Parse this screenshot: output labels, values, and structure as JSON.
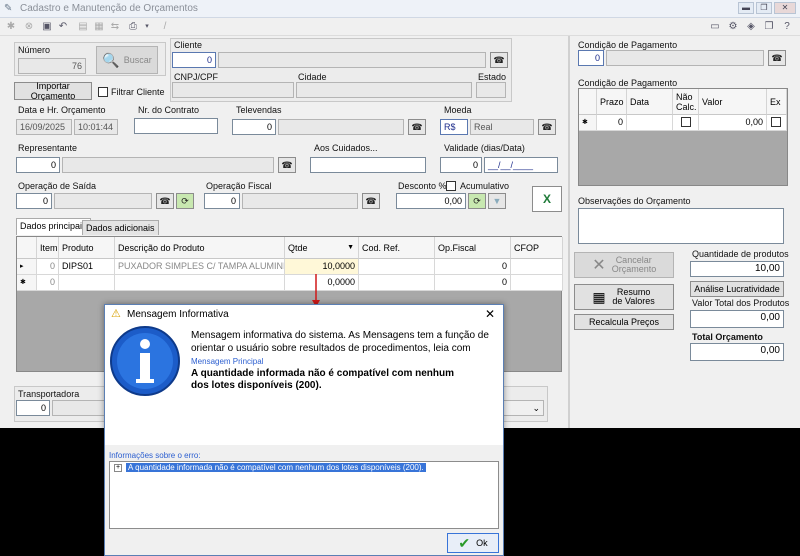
{
  "window": {
    "title": "Cadastro e Manutenção de Orçamentos"
  },
  "header": {
    "numero_label": "Número",
    "numero_value": "76",
    "buscar_label": "Buscar",
    "importar_label": "Importar Orçamento",
    "filtrar_label": "Filtrar Cliente",
    "cliente_label": "Cliente",
    "cliente_code": "0",
    "cnpj_label": "CNPJ/CPF",
    "cidade_label": "Cidade",
    "estado_label": "Estado"
  },
  "row2": {
    "data_label": "Data e Hr. Orçamento",
    "data_value": "16/09/2025",
    "hora_value": "10:01:44",
    "contrato_label": "Nr. do Contrato",
    "televendas_label": "Televendas",
    "televendas_value": "0",
    "moeda_label": "Moeda",
    "moeda_code": "R$",
    "moeda_name": "Real"
  },
  "row3": {
    "representante_label": "Representante",
    "representante_value": "0",
    "cuidados_label": "Aos Cuidados...",
    "validade_label": "Validade (dias/Data)",
    "validade_dias": "0",
    "validade_data": "__/__/____"
  },
  "row4": {
    "opsaida_label": "Operação de Saída",
    "opsaida_value": "0",
    "opfiscal_label": "Operação Fiscal",
    "opfiscal_value": "0",
    "desconto_label": "Desconto %",
    "acumulativo_label": "Acumulativo",
    "desconto_value": "0,00"
  },
  "tabs": [
    "Dados principais",
    "Dados adicionais"
  ],
  "items_grid": {
    "columns": [
      "Item",
      "Produto",
      "Descrição do Produto",
      "Qtde",
      "Cod. Ref.",
      "Op.Fiscal",
      "CFOP"
    ],
    "rows": [
      {
        "marker": "▸",
        "item": "0",
        "produto": "DIPS01",
        "descricao": "PUXADOR SIMPLES C/ TAMPA ALUMINIO",
        "qtde": "10,0000",
        "codref": "",
        "opfiscal": "0",
        "cfop": ""
      },
      {
        "marker": "✱",
        "item": "0",
        "produto": "",
        "descricao": "",
        "qtde": "0,0000",
        "codref": "",
        "opfiscal": "0",
        "cfop": ""
      }
    ]
  },
  "transportadora": {
    "label": "Transportadora",
    "value": "0"
  },
  "right": {
    "cond1_label": "Condição de Pagamento",
    "cond1_value": "0",
    "cond2_label": "Condição de Pagamento",
    "cond_grid": {
      "columns": [
        "Prazo",
        "Data",
        "Não Calc.",
        "Valor",
        "Ex"
      ],
      "row": {
        "marker": "✱",
        "prazo": "0",
        "data": "",
        "valor": "0,00"
      }
    },
    "obs_label": "Observações do Orçamento",
    "cancelar_label": "Cancelar Orçamento",
    "resumo_label": "Resumo de Valores",
    "recalcula_label": "Recalcula Preços",
    "qtd_label": "Quantidade de produtos",
    "qtd_value": "10,00",
    "lucratividade_label": "Análise Lucratividade",
    "valor_total_label": "Valor Total dos Produtos",
    "valor_total_value": "0,00",
    "total_orc_label": "Total Orçamento",
    "total_orc_value": "0,00"
  },
  "dialog": {
    "title": "Mensagem Informativa",
    "message": "Mensagem informativa do sistema. As Mensagens tem a função de orientar o usuário sobre resultados de procedimentos, leia com",
    "principal_label": "Mensagem Principal",
    "principal_text": "A quantidade informada não é compatível com nenhum dos lotes disponíveis (200).",
    "info_label": "Informações sobre o erro:",
    "tree_item": "A quantidade informada não é compatível com nenhum dos lotes disponíveis (200).",
    "ok_label": "Ok"
  },
  "colors": {
    "accent": "#3874d8",
    "arrow": "#d01818",
    "link": "#2c5fd0"
  }
}
